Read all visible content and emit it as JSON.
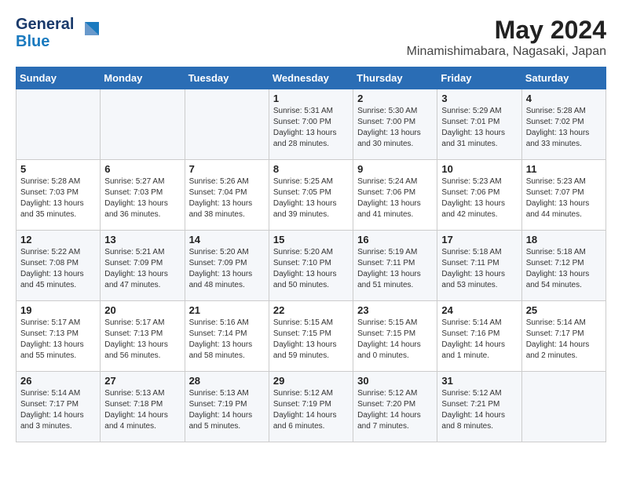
{
  "header": {
    "logo_line1": "General",
    "logo_line2": "Blue",
    "month_year": "May 2024",
    "location": "Minamishimabara, Nagasaki, Japan"
  },
  "weekdays": [
    "Sunday",
    "Monday",
    "Tuesday",
    "Wednesday",
    "Thursday",
    "Friday",
    "Saturday"
  ],
  "weeks": [
    [
      {
        "day": "",
        "info": ""
      },
      {
        "day": "",
        "info": ""
      },
      {
        "day": "",
        "info": ""
      },
      {
        "day": "1",
        "info": "Sunrise: 5:31 AM\nSunset: 7:00 PM\nDaylight: 13 hours\nand 28 minutes."
      },
      {
        "day": "2",
        "info": "Sunrise: 5:30 AM\nSunset: 7:00 PM\nDaylight: 13 hours\nand 30 minutes."
      },
      {
        "day": "3",
        "info": "Sunrise: 5:29 AM\nSunset: 7:01 PM\nDaylight: 13 hours\nand 31 minutes."
      },
      {
        "day": "4",
        "info": "Sunrise: 5:28 AM\nSunset: 7:02 PM\nDaylight: 13 hours\nand 33 minutes."
      }
    ],
    [
      {
        "day": "5",
        "info": "Sunrise: 5:28 AM\nSunset: 7:03 PM\nDaylight: 13 hours\nand 35 minutes."
      },
      {
        "day": "6",
        "info": "Sunrise: 5:27 AM\nSunset: 7:03 PM\nDaylight: 13 hours\nand 36 minutes."
      },
      {
        "day": "7",
        "info": "Sunrise: 5:26 AM\nSunset: 7:04 PM\nDaylight: 13 hours\nand 38 minutes."
      },
      {
        "day": "8",
        "info": "Sunrise: 5:25 AM\nSunset: 7:05 PM\nDaylight: 13 hours\nand 39 minutes."
      },
      {
        "day": "9",
        "info": "Sunrise: 5:24 AM\nSunset: 7:06 PM\nDaylight: 13 hours\nand 41 minutes."
      },
      {
        "day": "10",
        "info": "Sunrise: 5:23 AM\nSunset: 7:06 PM\nDaylight: 13 hours\nand 42 minutes."
      },
      {
        "day": "11",
        "info": "Sunrise: 5:23 AM\nSunset: 7:07 PM\nDaylight: 13 hours\nand 44 minutes."
      }
    ],
    [
      {
        "day": "12",
        "info": "Sunrise: 5:22 AM\nSunset: 7:08 PM\nDaylight: 13 hours\nand 45 minutes."
      },
      {
        "day": "13",
        "info": "Sunrise: 5:21 AM\nSunset: 7:09 PM\nDaylight: 13 hours\nand 47 minutes."
      },
      {
        "day": "14",
        "info": "Sunrise: 5:20 AM\nSunset: 7:09 PM\nDaylight: 13 hours\nand 48 minutes."
      },
      {
        "day": "15",
        "info": "Sunrise: 5:20 AM\nSunset: 7:10 PM\nDaylight: 13 hours\nand 50 minutes."
      },
      {
        "day": "16",
        "info": "Sunrise: 5:19 AM\nSunset: 7:11 PM\nDaylight: 13 hours\nand 51 minutes."
      },
      {
        "day": "17",
        "info": "Sunrise: 5:18 AM\nSunset: 7:11 PM\nDaylight: 13 hours\nand 53 minutes."
      },
      {
        "day": "18",
        "info": "Sunrise: 5:18 AM\nSunset: 7:12 PM\nDaylight: 13 hours\nand 54 minutes."
      }
    ],
    [
      {
        "day": "19",
        "info": "Sunrise: 5:17 AM\nSunset: 7:13 PM\nDaylight: 13 hours\nand 55 minutes."
      },
      {
        "day": "20",
        "info": "Sunrise: 5:17 AM\nSunset: 7:13 PM\nDaylight: 13 hours\nand 56 minutes."
      },
      {
        "day": "21",
        "info": "Sunrise: 5:16 AM\nSunset: 7:14 PM\nDaylight: 13 hours\nand 58 minutes."
      },
      {
        "day": "22",
        "info": "Sunrise: 5:15 AM\nSunset: 7:15 PM\nDaylight: 13 hours\nand 59 minutes."
      },
      {
        "day": "23",
        "info": "Sunrise: 5:15 AM\nSunset: 7:15 PM\nDaylight: 14 hours\nand 0 minutes."
      },
      {
        "day": "24",
        "info": "Sunrise: 5:14 AM\nSunset: 7:16 PM\nDaylight: 14 hours\nand 1 minute."
      },
      {
        "day": "25",
        "info": "Sunrise: 5:14 AM\nSunset: 7:17 PM\nDaylight: 14 hours\nand 2 minutes."
      }
    ],
    [
      {
        "day": "26",
        "info": "Sunrise: 5:14 AM\nSunset: 7:17 PM\nDaylight: 14 hours\nand 3 minutes."
      },
      {
        "day": "27",
        "info": "Sunrise: 5:13 AM\nSunset: 7:18 PM\nDaylight: 14 hours\nand 4 minutes."
      },
      {
        "day": "28",
        "info": "Sunrise: 5:13 AM\nSunset: 7:19 PM\nDaylight: 14 hours\nand 5 minutes."
      },
      {
        "day": "29",
        "info": "Sunrise: 5:12 AM\nSunset: 7:19 PM\nDaylight: 14 hours\nand 6 minutes."
      },
      {
        "day": "30",
        "info": "Sunrise: 5:12 AM\nSunset: 7:20 PM\nDaylight: 14 hours\nand 7 minutes."
      },
      {
        "day": "31",
        "info": "Sunrise: 5:12 AM\nSunset: 7:21 PM\nDaylight: 14 hours\nand 8 minutes."
      },
      {
        "day": "",
        "info": ""
      }
    ]
  ]
}
